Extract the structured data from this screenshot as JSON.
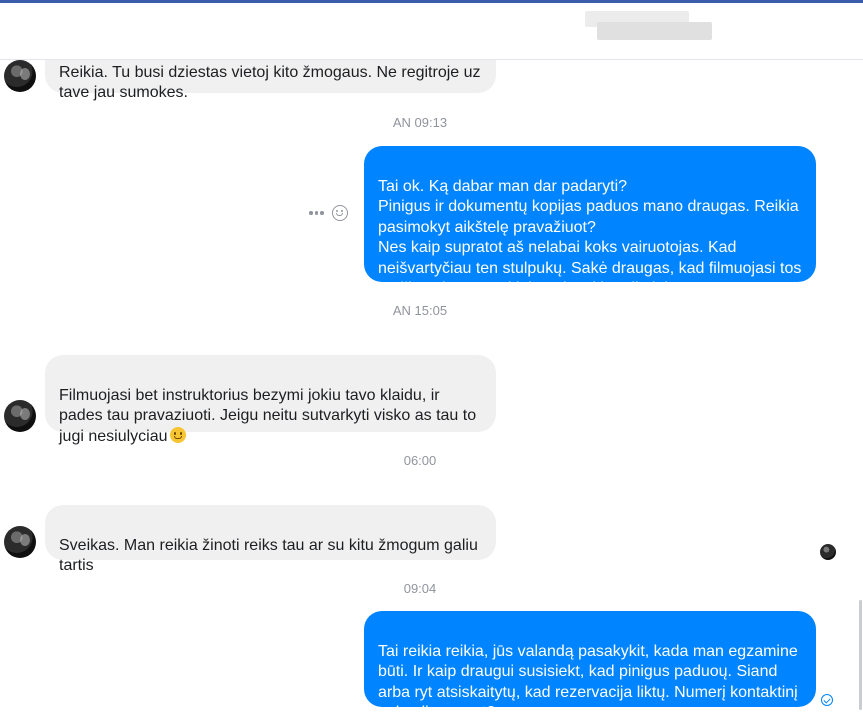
{
  "messages": [
    {
      "direction": "in",
      "text": "Reikia. Tu busi dziestas vietoj kito žmogaus. Ne regitroje uz\ntave jau sumokes."
    },
    {
      "direction": "out",
      "text": "Tai ok. Ką dabar man dar padaryti?\nPinigus ir dokumentų kopijas paduos mano draugas. Reikia pasimokyt aikštelę pravažiuot?\nNes kaip supratot aš nelabai koks vairuotojas. Kad neišvartyčiau ten stulpukų. Sakė draugas, kad filmuojasi tos mašinos ir ten sunkiai paeis tokie reikalai."
    },
    {
      "direction": "in",
      "text": "Filmuojasi bet instruktorius bezymi jokiu tavo klaidu, ir pades tau pravaziuoti. Jeigu neitu sutvarkyti visko as tau to jugi nesiulyciau"
    },
    {
      "direction": "in",
      "text": "Sveikas. Man reikia žinoti reiks tau ar su kitu žmogum galiu tartis"
    },
    {
      "direction": "out",
      "text": "Tai reikia reikia, jūs valandą pasakykit, kada man egzamine būti. Ir kaip draugui susisiekt, kad pinigus paduoų. Siand arba ryt atsiskaitytų, kad rezervacija liktų. Numerį kontaktinį gal galima gaut?"
    }
  ],
  "timestamps": [
    "AN 09:13",
    "AN 15:05",
    "06:00",
    "09:04"
  ],
  "icons": {
    "more": "more-dots-icon",
    "react": "emoji-react-icon",
    "emoji_in_message": "smiley-emoji-icon",
    "seen": "seen-check-icon"
  },
  "colors": {
    "outgoing_bubble": "#0084ff",
    "incoming_bubble": "#f0f0f0",
    "timestamp_text": "#90949c",
    "header_accent": "#3b5bab"
  }
}
